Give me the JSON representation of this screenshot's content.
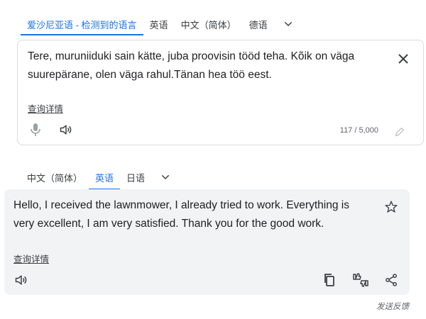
{
  "source_langs": {
    "tabs": [
      "爱沙尼亚语 - 检测到的语言",
      "英语",
      "中文（简体）",
      "德语"
    ],
    "more_icon": "chevron-down-icon"
  },
  "source": {
    "text": "Tere, muruniiduki sain kätte, juba proovisin tööd teha. Kõik on väga suurepärane, olen väga rahul.Tänan hea töö eest.",
    "details_link": "查询详情",
    "char_count": "117 / 5,000",
    "icons": [
      "close-icon",
      "microphone-icon",
      "speaker-icon",
      "pencil-icon"
    ]
  },
  "target_langs": {
    "tabs": [
      "中文（简体）",
      "英语",
      "日语"
    ],
    "more_icon": "chevron-down-icon"
  },
  "target": {
    "text": "Hello, I received the lawnmower, I already tried to work. Everything is very excellent, I am very satisfied. Thank you for the good work.",
    "details_link": "查询详情",
    "icons": [
      "star-icon",
      "speaker-icon",
      "copy-icon",
      "rate-translation-icon",
      "share-icon"
    ]
  },
  "feedback": "发送反馈",
  "colors": {
    "accent": "#1a73e8",
    "target_bg": "#f1f3f4",
    "border": "#dadce0",
    "icon": "#3c4043"
  }
}
